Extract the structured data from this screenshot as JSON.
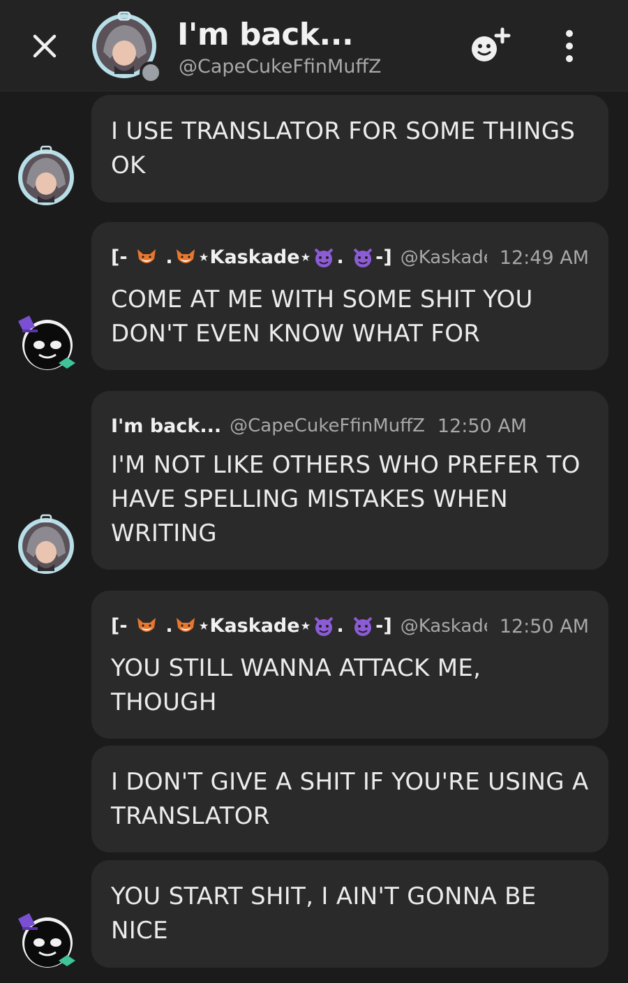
{
  "header": {
    "title": "I'm back...",
    "handle": "@CapeCukeFfinMuffZ"
  },
  "messages": [
    {
      "text": "I USE TRANSLATOR FOR SOME THINGS OK"
    },
    {
      "author_prefix": "[- ",
      "author_middle": " .",
      "author_name": "⋆Kaskade⋆",
      "author_dot": ".",
      "author_suffix": "-]",
      "handle": "@KaskadeF",
      "time": "12:49 AM",
      "text": "COME AT ME WITH SOME SHIT YOU DON'T EVEN KNOW WHAT FOR"
    },
    {
      "author_name": "I'm back...",
      "handle": "@CapeCukeFfinMuffZ",
      "time": "12:50 AM",
      "text": "I'M NOT LIKE OTHERS WHO PREFER TO HAVE SPELLING MISTAKES WHEN WRITING"
    },
    {
      "author_prefix": "[- ",
      "author_middle": " .",
      "author_name": "⋆Kaskade⋆",
      "author_dot": ".",
      "author_suffix": "-]",
      "handle": "@KaskadeF",
      "time": "12:50 AM",
      "text": "YOU STILL WANNA ATTACK ME, THOUGH"
    },
    {
      "text": "I DON'T GIVE A SHIT IF YOU'RE USING A TRANSLATOR"
    },
    {
      "text": "YOU START SHIT, I AIN'T GONNA BE NICE"
    }
  ],
  "icons": {
    "close": "close-icon",
    "add_friend": "add-friend-icon",
    "more": "more-vertical-icon",
    "fox": "fox-emoji-icon",
    "devil": "devil-emoji-icon"
  },
  "colors": {
    "background": "#1b1b1b",
    "header": "#232323",
    "bubble": "#2a2a2a",
    "devil_purple": "#8c5bd6",
    "fox_orange": "#e8772e"
  }
}
